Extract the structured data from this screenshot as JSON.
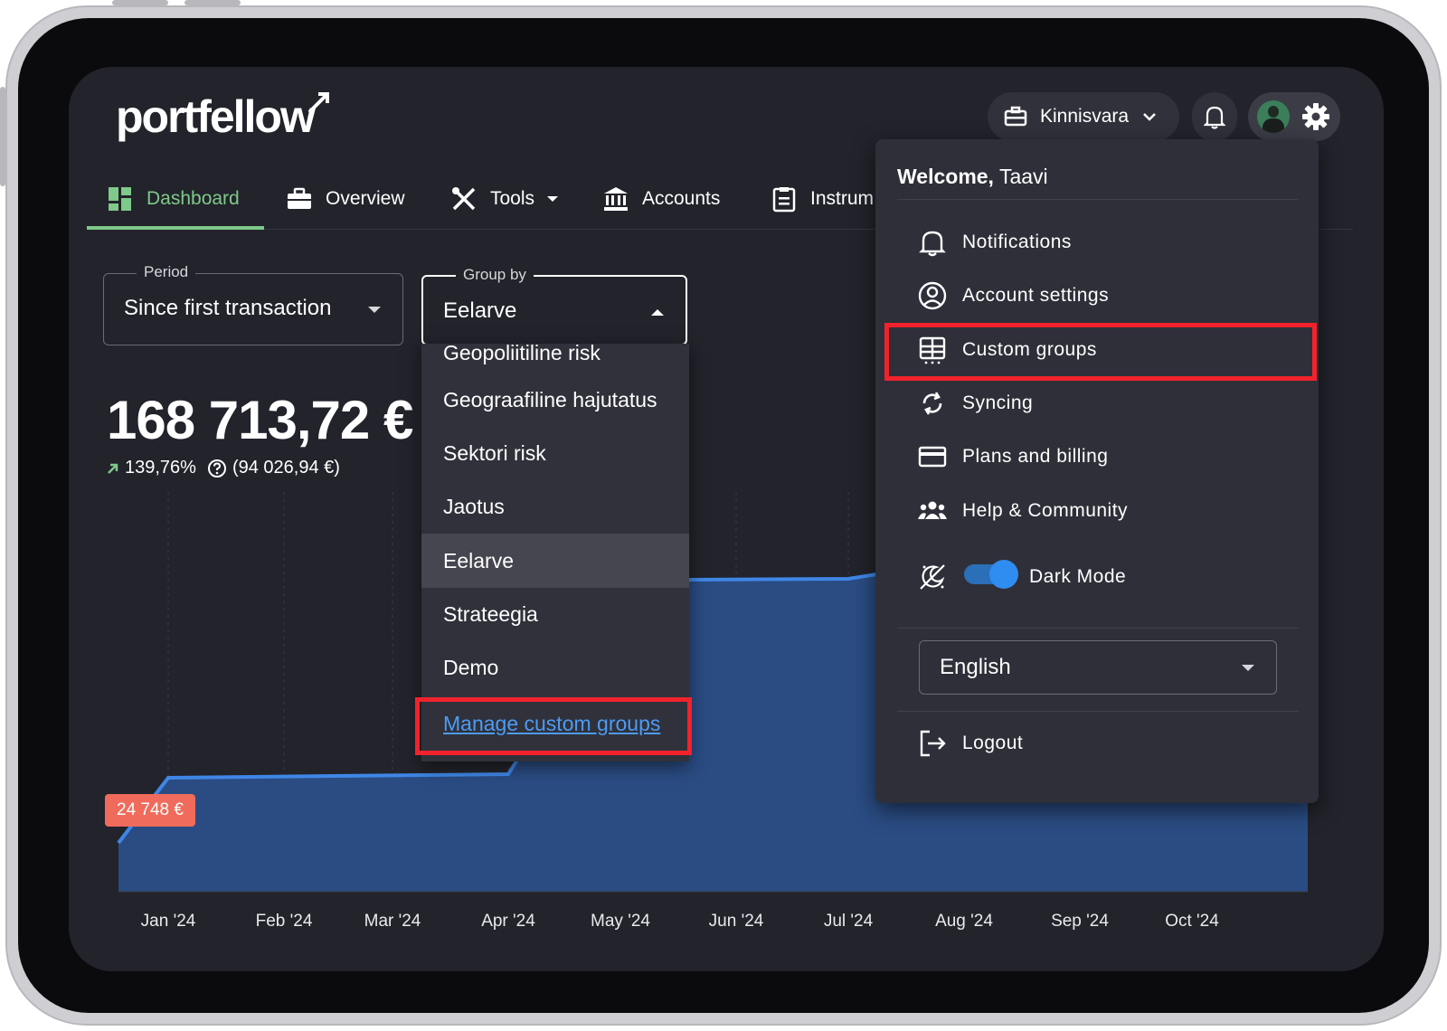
{
  "brand": {
    "logo_text": "portfellow"
  },
  "tabs": [
    {
      "label": "Dashboard",
      "icon": "dashboard-icon",
      "active": true
    },
    {
      "label": "Overview",
      "icon": "briefcase-icon"
    },
    {
      "label": "Tools",
      "icon": "tools-icon"
    },
    {
      "label": "Accounts",
      "icon": "bank-icon"
    },
    {
      "label": "Instrum",
      "icon": "clipboard-icon"
    }
  ],
  "header": {
    "portfolio_name": "Kinnisvara"
  },
  "filters": {
    "period": {
      "legend": "Period",
      "value": "Since first transaction"
    },
    "group_by": {
      "legend": "Group by",
      "value": "Eelarve"
    }
  },
  "summary": {
    "total": "168 713,72 €",
    "change_pct": "139,76%",
    "change_abs": "(94 026,94 €)"
  },
  "group_by_options": {
    "items": [
      "Geopoliitiline risk",
      "Geograafiline hajutatus",
      "Sektori risk",
      "Jaotus",
      "Eelarve",
      "Strateegia",
      "Demo"
    ],
    "selected": "Eelarve",
    "manage_link": "Manage custom groups"
  },
  "user_menu": {
    "welcome_prefix": "Welcome,",
    "user_name": "Taavi",
    "items": [
      {
        "label": "Notifications",
        "icon": "bell-icon"
      },
      {
        "label": "Account settings",
        "icon": "account-circle-icon"
      },
      {
        "label": "Custom groups",
        "icon": "grid-icon"
      },
      {
        "label": "Syncing",
        "icon": "sync-icon"
      },
      {
        "label": "Plans and billing",
        "icon": "credit-card-icon"
      },
      {
        "label": "Help & Community",
        "icon": "people-icon"
      }
    ],
    "dark_mode_label": "Dark Mode",
    "dark_mode_on": true,
    "language": "English",
    "logout_label": "Logout"
  },
  "chart_data": {
    "type": "area",
    "x": [
      "Jan '24",
      "Feb '24",
      "Mar '24",
      "Apr '24",
      "May '24",
      "Jun '24",
      "Jul '24",
      "Aug '24",
      "Sep '24",
      "Oct '24"
    ],
    "start_label": "24 748 €",
    "colors": {
      "line": "#3f86e6",
      "fill": "#2a4c83"
    }
  },
  "colors": {
    "accent_green": "#7fc98a",
    "highlight_red": "#f2222c",
    "link_blue": "#4c9bf5",
    "screen_bg": "#22232b"
  }
}
